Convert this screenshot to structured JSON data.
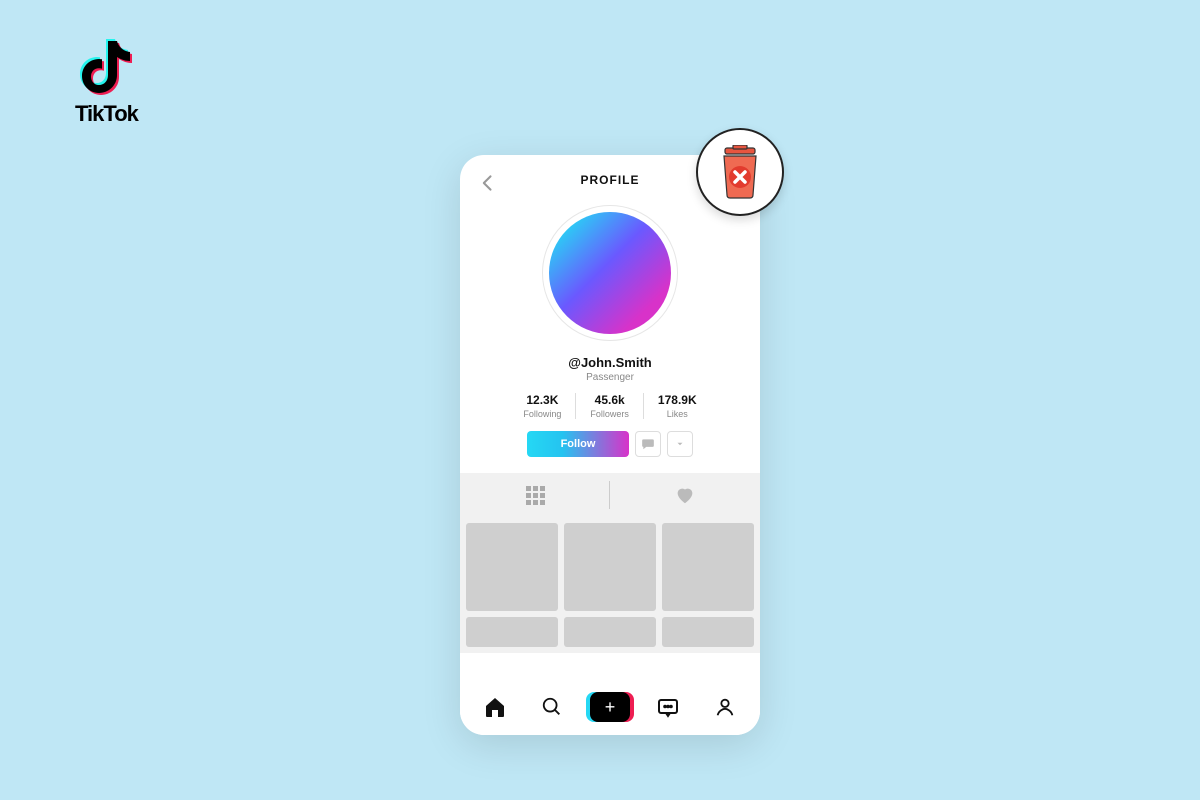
{
  "brand": {
    "name": "TikTok"
  },
  "header": {
    "title": "PROFILE"
  },
  "profile": {
    "username": "@John.Smith",
    "subtitle": "Passenger",
    "stats": {
      "following": {
        "value": "12.3K",
        "label": "Following"
      },
      "followers": {
        "value": "45.6k",
        "label": "Followers"
      },
      "likes": {
        "value": "178.9K",
        "label": "Likes"
      }
    },
    "follow_label": "Follow"
  },
  "navbar": {
    "create_label": "+"
  }
}
